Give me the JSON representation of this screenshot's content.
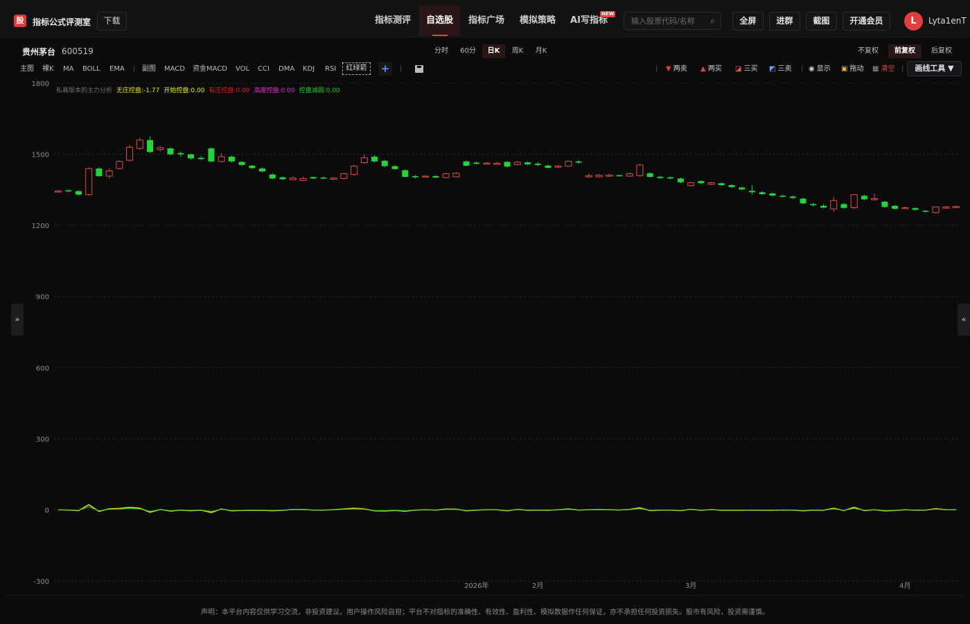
{
  "header": {
    "logo_text": "股",
    "app_title": "指标公式评测室",
    "download_label": "下载",
    "nav": [
      {
        "label": "指标测评",
        "active": false
      },
      {
        "label": "自选股",
        "active": true
      },
      {
        "label": "指标广场",
        "active": false
      },
      {
        "label": "模拟策略",
        "active": false
      },
      {
        "label": "AI写指标",
        "active": false
      }
    ],
    "new_badge": "NEW",
    "search_placeholder": "输入股票代码/名称",
    "buttons": [
      "全屏",
      "进群",
      "截图",
      "开通会员"
    ],
    "avatar_letter": "L",
    "username": "Lyta1enT"
  },
  "stock": {
    "name": "贵州茅台",
    "code": "600519"
  },
  "periods": [
    {
      "label": "分时",
      "active": false
    },
    {
      "label": "60分",
      "active": false
    },
    {
      "label": "日K",
      "active": true
    },
    {
      "label": "周K",
      "active": false
    },
    {
      "label": "月K",
      "active": false
    }
  ],
  "adjust": [
    {
      "label": "不复权",
      "active": false
    },
    {
      "label": "前复权",
      "active": true
    },
    {
      "label": "后复权",
      "active": false
    }
  ],
  "indicator_bar": {
    "main": [
      "主图",
      "裸K",
      "MA",
      "BOLL",
      "EMA"
    ],
    "sub": [
      "副图",
      "MACD",
      "资金MACD",
      "VOL",
      "CCI",
      "DMA",
      "KDJ",
      "RSI"
    ],
    "redgreen": "红绿箭",
    "plus": "+"
  },
  "tools": {
    "items": [
      {
        "label": "两卖",
        "glyph": "▼"
      },
      {
        "label": "两买",
        "glyph": "▲"
      },
      {
        "label": "三买",
        "glyph": "◪"
      },
      {
        "label": "三卖",
        "glyph": "◩"
      }
    ],
    "show": "显示",
    "drag": "拖动",
    "clear": "清空",
    "draw_tool": "画线工具 ▼"
  },
  "legend": [
    {
      "text": "私募版本的主力分析",
      "color": "#6e6e6e"
    },
    {
      "text": "无庄控盘:-1.77",
      "color": "#e8e800"
    },
    {
      "text": "开始控盘:0.00",
      "color": "#f0f000"
    },
    {
      "text": "有庄控盘:0.00",
      "color": "#e02020"
    },
    {
      "text": "高度控盘:0.00",
      "color": "#e030e0"
    },
    {
      "text": "控盘减弱:0.00",
      "color": "#20d020"
    }
  ],
  "side_left": "»",
  "side_right": "«",
  "disclaimer": "声明：本平台内容仅供学习交流，非投资建议。用户操作风险自担；平台不对指标的准确性、有效性、盈利性、模拟数据作任何保证，亦不承担任何投资损失。股市有风险，投资需谨慎。",
  "chart_data": {
    "type": "candlestick",
    "ylim": [
      -300,
      1800
    ],
    "y_ticks": [
      1800,
      1500,
      1200,
      900,
      600,
      300,
      0,
      -300
    ],
    "x_labels": [
      {
        "text": "2026年",
        "index": 41
      },
      {
        "text": "2月",
        "index": 47
      },
      {
        "text": "3月",
        "index": 62
      },
      {
        "text": "4月",
        "index": 83
      }
    ],
    "candles": [
      [
        1345,
        1345,
        1340,
        1350
      ],
      [
        1348,
        1345,
        1340,
        1352
      ],
      [
        1345,
        1330,
        1327,
        1348
      ],
      [
        1330,
        1440,
        1325,
        1445
      ],
      [
        1440,
        1408,
        1405,
        1445
      ],
      [
        1408,
        1430,
        1398,
        1440
      ],
      [
        1440,
        1470,
        1436,
        1475
      ],
      [
        1475,
        1530,
        1470,
        1540
      ],
      [
        1525,
        1560,
        1520,
        1570
      ],
      [
        1560,
        1510,
        1505,
        1575
      ],
      [
        1520,
        1528,
        1512,
        1535
      ],
      [
        1525,
        1500,
        1495,
        1530
      ],
      [
        1505,
        1500,
        1490,
        1512
      ],
      [
        1500,
        1483,
        1477,
        1503
      ],
      [
        1485,
        1480,
        1475,
        1493
      ],
      [
        1525,
        1470,
        1466,
        1530
      ],
      [
        1470,
        1490,
        1466,
        1505
      ],
      [
        1490,
        1470,
        1465,
        1495
      ],
      [
        1468,
        1455,
        1450,
        1471
      ],
      [
        1452,
        1442,
        1438,
        1455
      ],
      [
        1440,
        1428,
        1424,
        1445
      ],
      [
        1415,
        1398,
        1395,
        1420
      ],
      [
        1403,
        1395,
        1391,
        1406
      ],
      [
        1393,
        1400,
        1389,
        1406
      ],
      [
        1390,
        1398,
        1386,
        1405
      ],
      [
        1404,
        1398,
        1395,
        1406
      ],
      [
        1402,
        1398,
        1396,
        1406
      ],
      [
        1395,
        1400,
        1392,
        1404
      ],
      [
        1398,
        1418,
        1395,
        1422
      ],
      [
        1415,
        1450,
        1410,
        1455
      ],
      [
        1465,
        1485,
        1460,
        1500
      ],
      [
        1490,
        1470,
        1466,
        1496
      ],
      [
        1473,
        1450,
        1446,
        1476
      ],
      [
        1450,
        1438,
        1434,
        1455
      ],
      [
        1433,
        1405,
        1402,
        1436
      ],
      [
        1408,
        1403,
        1398,
        1412
      ],
      [
        1405,
        1408,
        1403,
        1412
      ],
      [
        1408,
        1402,
        1399,
        1412
      ],
      [
        1402,
        1418,
        1398,
        1423
      ],
      [
        1405,
        1420,
        1401,
        1425
      ],
      [
        1470,
        1452,
        1449,
        1474
      ],
      [
        1465,
        1460,
        1457,
        1470
      ],
      [
        1460,
        1463,
        1458,
        1468
      ],
      [
        1460,
        1462,
        1458,
        1468
      ],
      [
        1468,
        1448,
        1445,
        1471
      ],
      [
        1457,
        1467,
        1453,
        1471
      ],
      [
        1466,
        1458,
        1454,
        1469
      ],
      [
        1460,
        1455,
        1450,
        1466
      ],
      [
        1452,
        1443,
        1440,
        1458
      ],
      [
        1446,
        1450,
        1443,
        1456
      ],
      [
        1450,
        1471,
        1447,
        1474
      ],
      [
        1470,
        1465,
        1460,
        1476
      ],
      [
        1405,
        1410,
        1400,
        1420
      ],
      [
        1405,
        1412,
        1402,
        1416
      ],
      [
        1410,
        1412,
        1405,
        1418
      ],
      [
        1412,
        1410,
        1406,
        1415
      ],
      [
        1408,
        1418,
        1405,
        1422
      ],
      [
        1410,
        1455,
        1406,
        1460
      ],
      [
        1420,
        1405,
        1402,
        1424
      ],
      [
        1405,
        1400,
        1397,
        1410
      ],
      [
        1403,
        1398,
        1395,
        1407
      ],
      [
        1398,
        1382,
        1378,
        1402
      ],
      [
        1368,
        1380,
        1364,
        1384
      ],
      [
        1387,
        1378,
        1374,
        1390
      ],
      [
        1374,
        1380,
        1370,
        1384
      ],
      [
        1378,
        1370,
        1366,
        1382
      ],
      [
        1370,
        1362,
        1358,
        1374
      ],
      [
        1360,
        1352,
        1348,
        1364
      ],
      [
        1346,
        1340,
        1330,
        1370
      ],
      [
        1340,
        1332,
        1328,
        1344
      ],
      [
        1335,
        1326,
        1322,
        1339
      ],
      [
        1325,
        1322,
        1318,
        1330
      ],
      [
        1322,
        1316,
        1312,
        1326
      ],
      [
        1313,
        1293,
        1289,
        1317
      ],
      [
        1290,
        1285,
        1280,
        1296
      ],
      [
        1283,
        1275,
        1272,
        1290
      ],
      [
        1270,
        1305,
        1258,
        1320
      ],
      [
        1290,
        1274,
        1270,
        1295
      ],
      [
        1275,
        1330,
        1270,
        1333
      ],
      [
        1325,
        1310,
        1306,
        1330
      ],
      [
        1310,
        1313,
        1305,
        1335
      ],
      [
        1300,
        1278,
        1274,
        1303
      ],
      [
        1283,
        1270,
        1266,
        1286
      ],
      [
        1272,
        1275,
        1270,
        1280
      ],
      [
        1273,
        1266,
        1262,
        1276
      ],
      [
        1262,
        1258,
        1255,
        1265
      ],
      [
        1254,
        1278,
        1250,
        1280
      ],
      [
        1273,
        1278,
        1270,
        1283
      ],
      [
        1276,
        1280,
        1272,
        1283
      ]
    ]
  }
}
